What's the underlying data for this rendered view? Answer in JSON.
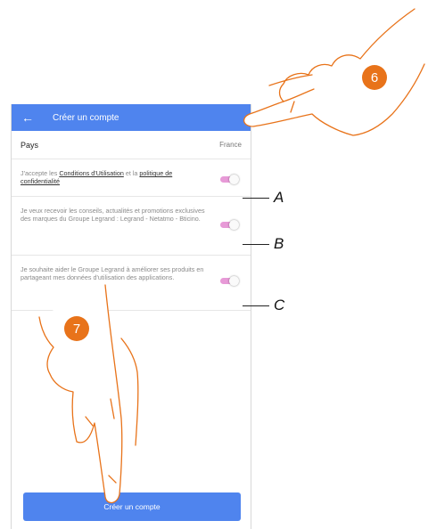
{
  "app_bar": {
    "back_icon": "arrow-left-icon",
    "title": "Créer un compte",
    "color": "#4f84ee"
  },
  "country_row": {
    "label": "Pays",
    "value": "France"
  },
  "consents": [
    {
      "text_before": "J'accepte les ",
      "link1": "Conditions d'Utilisation",
      "text_middle": " et la ",
      "link2": "politique de confidentialité",
      "enabled": true,
      "callout": "A"
    },
    {
      "text": "Je veux recevoir les conseils, actualités et promotions exclusives des marques du Groupe Legrand : Legrand - Netatmo - Bticino.",
      "enabled": true,
      "callout": "B"
    },
    {
      "text": "Je souhaite aider le Groupe Legrand à améliorer ses produits en partageant mes données d'utilisation des applications.",
      "enabled": true,
      "callout": "C"
    }
  ],
  "create_button": {
    "label": "Créer un compte"
  },
  "toggle_color": "#e79ad7",
  "steps": [
    {
      "number": "6"
    },
    {
      "number": "7"
    }
  ],
  "badge_color": "#e8731a"
}
